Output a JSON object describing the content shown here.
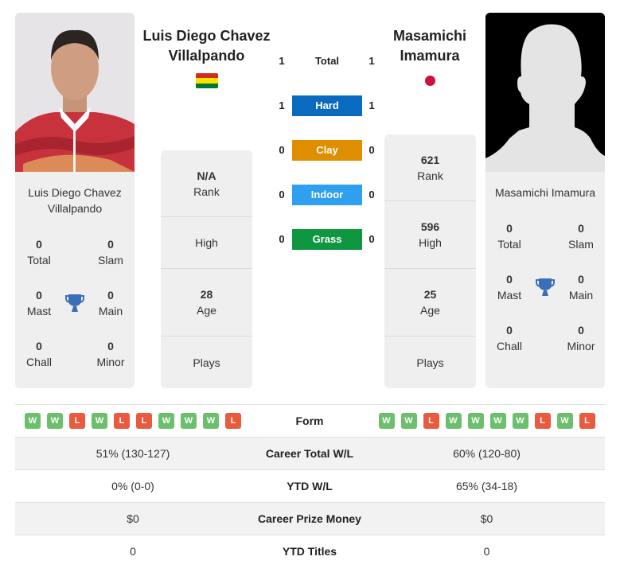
{
  "left_player": {
    "name": "Luis Diego Chavez Villalpando",
    "name_line1": "Luis Diego Chavez",
    "name_line2": "Villalpando",
    "flag": "bolivia-flag",
    "card_name_line1": "Luis Diego Chavez",
    "card_name_line2": "Villalpando",
    "titles": {
      "total": {
        "value": "0",
        "label": "Total"
      },
      "slam": {
        "value": "0",
        "label": "Slam"
      },
      "mast": {
        "value": "0",
        "label": "Mast"
      },
      "main": {
        "value": "0",
        "label": "Main"
      },
      "chall": {
        "value": "0",
        "label": "Chall"
      },
      "minor": {
        "value": "0",
        "label": "Minor"
      }
    },
    "info": {
      "rank": {
        "value": "N/A",
        "label": "Rank"
      },
      "high": {
        "value": "",
        "label": "High"
      },
      "age": {
        "value": "28",
        "label": "Age"
      },
      "plays": {
        "value": "",
        "label": "Plays"
      }
    }
  },
  "right_player": {
    "name": "Masamichi Imamura",
    "name_line1": "Masamichi",
    "name_line2": "Imamura",
    "flag": "japan-flag",
    "card_name": "Masamichi Imamura",
    "titles": {
      "total": {
        "value": "0",
        "label": "Total"
      },
      "slam": {
        "value": "0",
        "label": "Slam"
      },
      "mast": {
        "value": "0",
        "label": "Mast"
      },
      "main": {
        "value": "0",
        "label": "Main"
      },
      "chall": {
        "value": "0",
        "label": "Chall"
      },
      "minor": {
        "value": "0",
        "label": "Minor"
      }
    },
    "info": {
      "rank": {
        "value": "621",
        "label": "Rank"
      },
      "high": {
        "value": "596",
        "label": "High"
      },
      "age": {
        "value": "25",
        "label": "Age"
      },
      "plays": {
        "value": "",
        "label": "Plays"
      }
    }
  },
  "h2h": {
    "total": {
      "label": "Total",
      "left": "1",
      "right": "1"
    },
    "surfaces": [
      {
        "label": "Hard",
        "left": "1",
        "right": "1",
        "color": "#0a6abf"
      },
      {
        "label": "Clay",
        "left": "0",
        "right": "0",
        "color": "#df8e00"
      },
      {
        "label": "Indoor",
        "left": "0",
        "right": "0",
        "color": "#2fa0f0"
      },
      {
        "label": "Grass",
        "left": "0",
        "right": "0",
        "color": "#0e9640"
      }
    ]
  },
  "comparison": {
    "form": {
      "label": "Form",
      "left": [
        "W",
        "W",
        "L",
        "W",
        "L",
        "L",
        "W",
        "W",
        "W",
        "L"
      ],
      "right": [
        "W",
        "W",
        "L",
        "W",
        "W",
        "W",
        "W",
        "L",
        "W",
        "L"
      ]
    },
    "rows": [
      {
        "label": "Career Total W/L",
        "left": "51% (130-127)",
        "right": "60% (120-80)"
      },
      {
        "label": "YTD W/L",
        "left": "0% (0-0)",
        "right": "65% (34-18)"
      },
      {
        "label": "Career Prize Money",
        "left": "$0",
        "right": "$0"
      },
      {
        "label": "YTD Titles",
        "left": "0",
        "right": "0"
      }
    ]
  },
  "colors": {
    "win": "#6cbf6c",
    "loss": "#ea5a3f",
    "trophy": "#3a6fb8",
    "japan_red": "#d0103a"
  }
}
